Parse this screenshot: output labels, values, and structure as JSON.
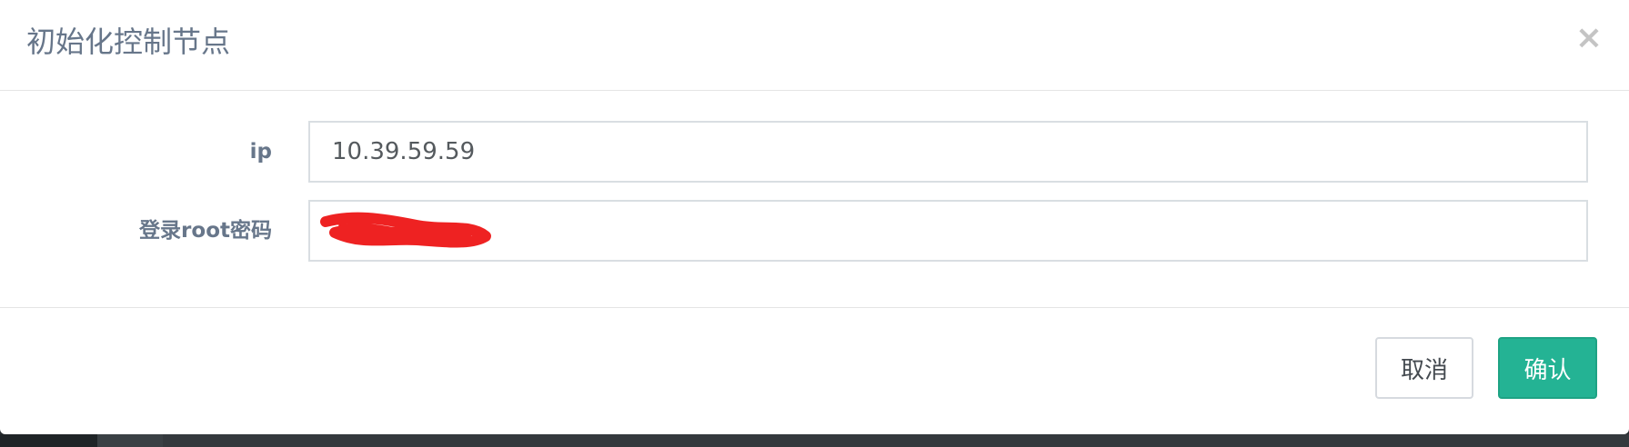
{
  "modal": {
    "title": "初始化控制节点",
    "close_label": "×"
  },
  "form": {
    "ip": {
      "label": "ip",
      "value": "10.39.59.59"
    },
    "root_password": {
      "label": "登录root密码",
      "value": ""
    }
  },
  "footer": {
    "cancel_label": "取消",
    "confirm_label": "确认"
  },
  "colors": {
    "primary": "#24b394",
    "label_text": "#67768a",
    "redaction": "#ee2222"
  }
}
